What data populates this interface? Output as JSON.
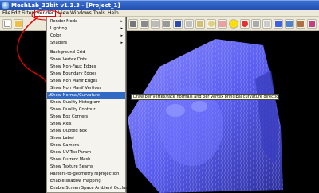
{
  "window": {
    "title": "MeshLab_32bit v1.3.3 - [Project_1]"
  },
  "menubar": {
    "items": [
      "File",
      "Edit",
      "Filters",
      "Render",
      "View",
      "Windows",
      "Tools",
      "Help"
    ]
  },
  "render_menu": {
    "submenus": [
      "Render Mode",
      "Lighting",
      "Color",
      "Shaders"
    ],
    "items": [
      "Background Grid",
      "Show Vertex Dots",
      "Show Non-Faux Edges",
      "Show Boundary Edges",
      "Show Non Manif Edges",
      "Show Non Manif Vertices",
      "Show Normal/Curvature",
      "Show Quality Histogram",
      "Show Quality Contour",
      "Show Box Corners",
      "Show Axis",
      "Show Quoted Box",
      "Show Label",
      "Show Camera",
      "Show UV Tex Param",
      "Show Current Mesh",
      "Show Texture Seams",
      "Rasters-to-geometry reprojection",
      "Enable shadow mapping",
      "Enable Screen Space Ambient Occlusion"
    ],
    "selected_index": 6
  },
  "tooltip": {
    "text": "Draw per vertex/face normals and per vertex principal curvature directions"
  },
  "colors": {
    "accent": "#316ac5",
    "mesh": "#6a6cf0",
    "annotation": "#e00000"
  }
}
